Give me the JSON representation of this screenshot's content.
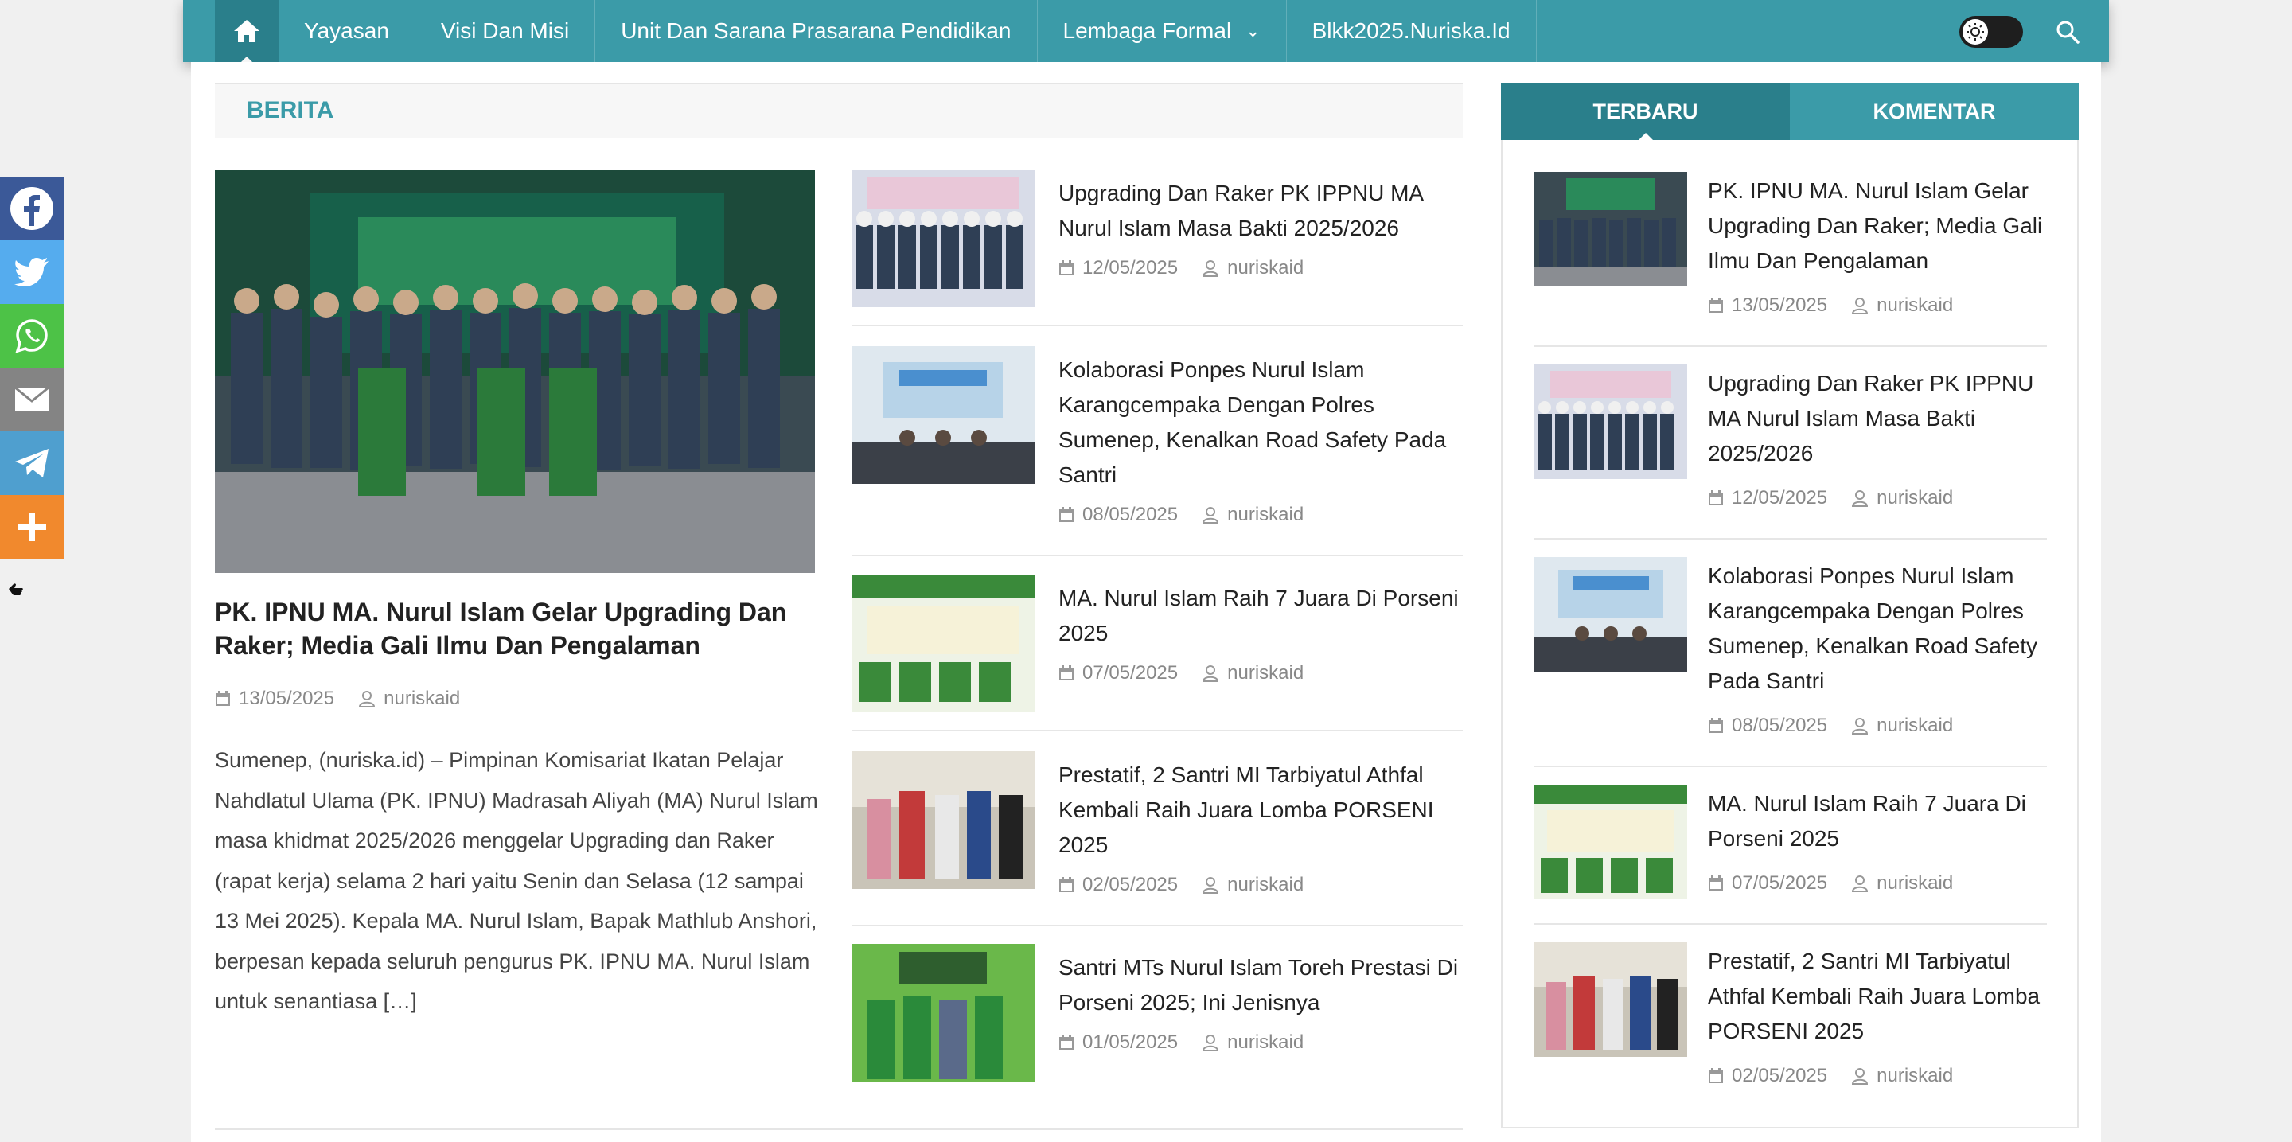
{
  "nav": {
    "home_icon": "home-icon",
    "items": [
      {
        "label": "Yayasan"
      },
      {
        "label": "Visi Dan Misi"
      },
      {
        "label": "Unit Dan Sarana Prasarana Pendidikan"
      },
      {
        "label": "Lembaga Formal",
        "has_dropdown": true
      },
      {
        "label": "Blkk2025.Nuriska.Id"
      }
    ],
    "theme_icon": "sun-icon",
    "search_icon": "search-icon"
  },
  "section": {
    "title": "BERITA"
  },
  "featured": {
    "image_alt": "PK. IPNU MANISKA group photo",
    "title": "PK. IPNU MA. Nurul Islam Gelar Upgrading Dan Raker; Media Gali Ilmu Dan Pengalaman",
    "date": "13/05/2025",
    "author": "nuriskaid",
    "excerpt": "Sumenep, (nuriska.id) – Pimpinan Komisariat Ikatan Pelajar Nahdlatul Ulama (PK. IPNU) Madrasah Aliyah (MA) Nurul Islam masa khidmat 2025/2026 menggelar Upgrading dan Raker (rapat kerja) selama 2 hari yaitu Senin dan Selasa (12 sampai 13 Mei 2025). Kepala MA. Nurul Islam, Bapak Mathlub Anshori, berpesan kepada seluruh pengurus PK. IPNU MA. Nurul Islam untuk senantiasa […]"
  },
  "middle_list": [
    {
      "title": "Upgrading Dan Raker PK IPPNU MA Nurul Islam Masa Bakti 2025/2026",
      "date": "12/05/2025",
      "author": "nuriskaid"
    },
    {
      "title": "Kolaborasi Ponpes Nurul Islam Karangcempaka Dengan Polres Sumenep, Kenalkan Road Safety Pada Santri",
      "date": "08/05/2025",
      "author": "nuriskaid"
    },
    {
      "title": "MA. Nurul Islam Raih 7 Juara Di Porseni 2025",
      "date": "07/05/2025",
      "author": "nuriskaid"
    },
    {
      "title": "Prestatif, 2 Santri MI Tarbiyatul Athfal Kembali Raih Juara Lomba PORSENI 2025",
      "date": "02/05/2025",
      "author": "nuriskaid"
    },
    {
      "title": "Santri MTs Nurul Islam Toreh Prestasi Di Porseni 2025; Ini Jenisnya",
      "date": "01/05/2025",
      "author": "nuriskaid"
    }
  ],
  "sidebar": {
    "tabs": [
      {
        "label": "TERBARU",
        "active": true
      },
      {
        "label": "KOMENTAR",
        "active": false
      }
    ],
    "items": [
      {
        "title": "PK. IPNU MA. Nurul Islam Gelar Upgrading Dan Raker; Media Gali Ilmu Dan Pengalaman",
        "date": "13/05/2025",
        "author": "nuriskaid"
      },
      {
        "title": "Upgrading Dan Raker PK IPPNU MA Nurul Islam Masa Bakti 2025/2026",
        "date": "12/05/2025",
        "author": "nuriskaid"
      },
      {
        "title": "Kolaborasi Ponpes Nurul Islam Karangcempaka Dengan Polres Sumenep, Kenalkan Road Safety Pada Santri",
        "date": "08/05/2025",
        "author": "nuriskaid"
      },
      {
        "title": "MA. Nurul Islam Raih 7 Juara Di Porseni 2025",
        "date": "07/05/2025",
        "author": "nuriskaid"
      },
      {
        "title": "Prestatif, 2 Santri MI Tarbiyatul Athfal Kembali Raih Juara Lomba PORSENI 2025",
        "date": "02/05/2025",
        "author": "nuriskaid"
      }
    ]
  },
  "share": [
    {
      "name": "facebook",
      "icon": "facebook-icon",
      "color": "#3b5998"
    },
    {
      "name": "twitter",
      "icon": "twitter-icon",
      "color": "#55acee"
    },
    {
      "name": "whatsapp",
      "icon": "whatsapp-icon",
      "color": "#4dc247"
    },
    {
      "name": "email",
      "icon": "email-icon",
      "color": "#848484"
    },
    {
      "name": "telegram",
      "icon": "telegram-icon",
      "color": "#4f9fcf"
    },
    {
      "name": "more",
      "icon": "plus-icon",
      "color": "#f1892d"
    }
  ],
  "colors": {
    "accent": "#3b9ba8",
    "accent_dark": "#2a7f8b"
  }
}
